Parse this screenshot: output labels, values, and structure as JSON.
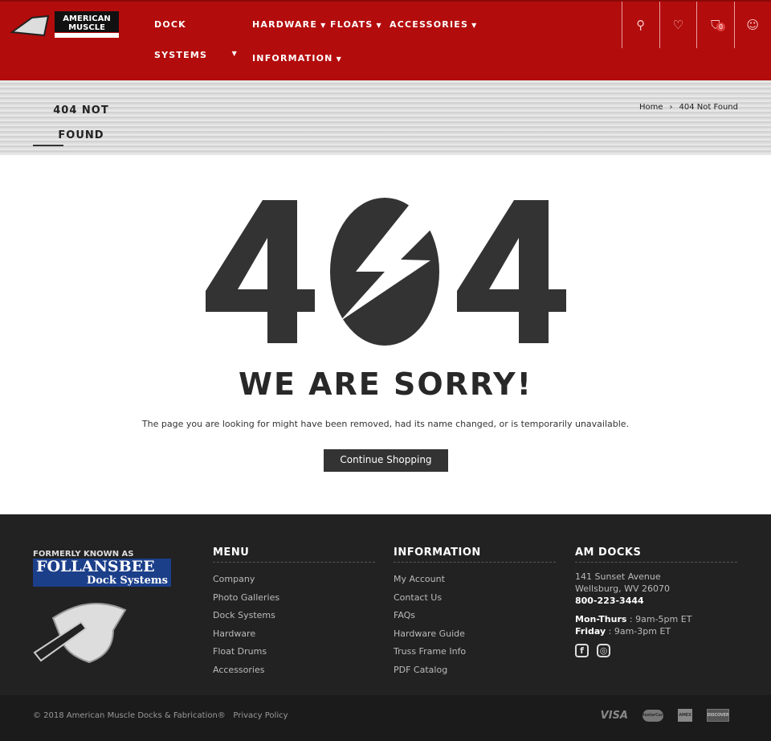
{
  "header": {
    "logo_text": "AMERICAN MUSCLE DOCKS & FABRICATION",
    "nav": [
      {
        "label": "DOCK SYSTEMS"
      },
      {
        "label": "HARDWARE"
      },
      {
        "label": "FLOATS"
      },
      {
        "label": "ACCESSORIES"
      },
      {
        "label": "INFORMATION"
      }
    ],
    "nav_dock_1": "DOCK",
    "nav_dock_2": "SYSTEMS",
    "icons": [
      "search-icon",
      "heart-icon",
      "cart-icon",
      "user-icon"
    ],
    "cart_count": "0",
    "accent": "#b30c0c"
  },
  "banner": {
    "title": "404 NOT FOUND",
    "breadcrumb": [
      "Home",
      "404 Not Found"
    ],
    "sep": "›"
  },
  "main": {
    "code": "404",
    "heading": "WE ARE SORRY!",
    "message": "The page you are looking for might have been removed, had its name changed, or is temporarily unavailable.",
    "button": "Continue Shopping"
  },
  "footer": {
    "logo_caption": "FORMERLY KNOWN AS",
    "logo_name": "FOLLANSBEE",
    "logo_sub": "Dock Systems",
    "menu": {
      "title": "MENU",
      "items": [
        "Company",
        "Photo Galleries",
        "Dock Systems",
        "Hardware",
        "Float Drums",
        "Accessories"
      ]
    },
    "information": {
      "title": "INFORMATION",
      "items": [
        "My Account",
        "Contact Us",
        "FAQs",
        "Hardware Guide",
        "Truss Frame Info",
        "PDF Catalog"
      ]
    },
    "contact": {
      "title": "AM DOCKS",
      "street": "141 Sunset Avenue",
      "city": "Wellsburg, WV 26070",
      "phone": "800-223-3444",
      "hours1_label": "Mon-Thurs",
      "hours1": " : 9am-5pm ET",
      "hours2_label": "Friday",
      "hours2": " : 9am-3pm ET"
    },
    "copyright": "© 2018 American Muscle Docks & Fabrication®",
    "privacy": "Privacy Policy",
    "payments": [
      "VISA",
      "MasterCard",
      "AMEX",
      "DISCOVER"
    ]
  }
}
